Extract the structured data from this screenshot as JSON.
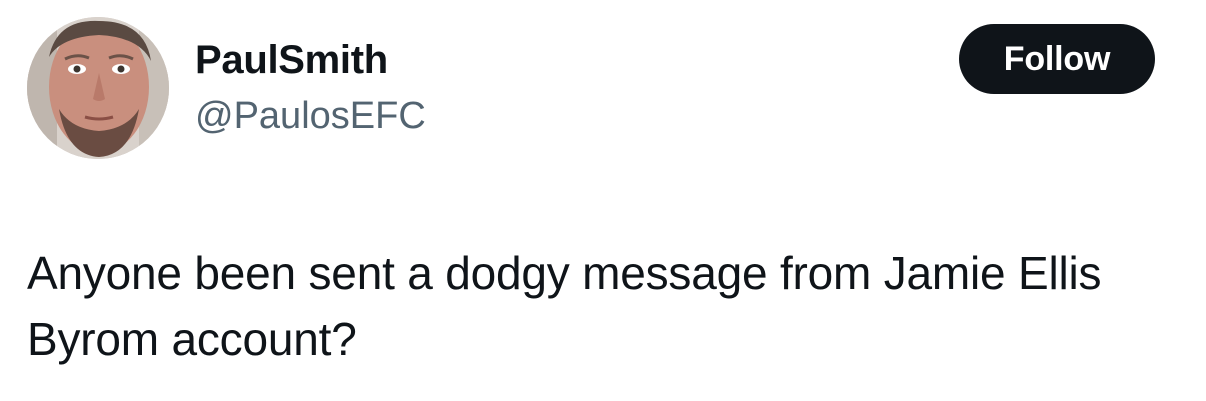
{
  "author": {
    "display_name": "PaulSmith",
    "handle": "@PaulosEFC",
    "avatar_icon": "user-avatar-photo"
  },
  "actions": {
    "follow_label": "Follow"
  },
  "tweet": {
    "text": "Anyone been sent a dodgy message from Jamie Ellis Byrom account?"
  },
  "colors": {
    "primary_text": "#0f1419",
    "secondary_text": "#536471",
    "button_bg": "#0f1419",
    "button_text": "#ffffff"
  }
}
